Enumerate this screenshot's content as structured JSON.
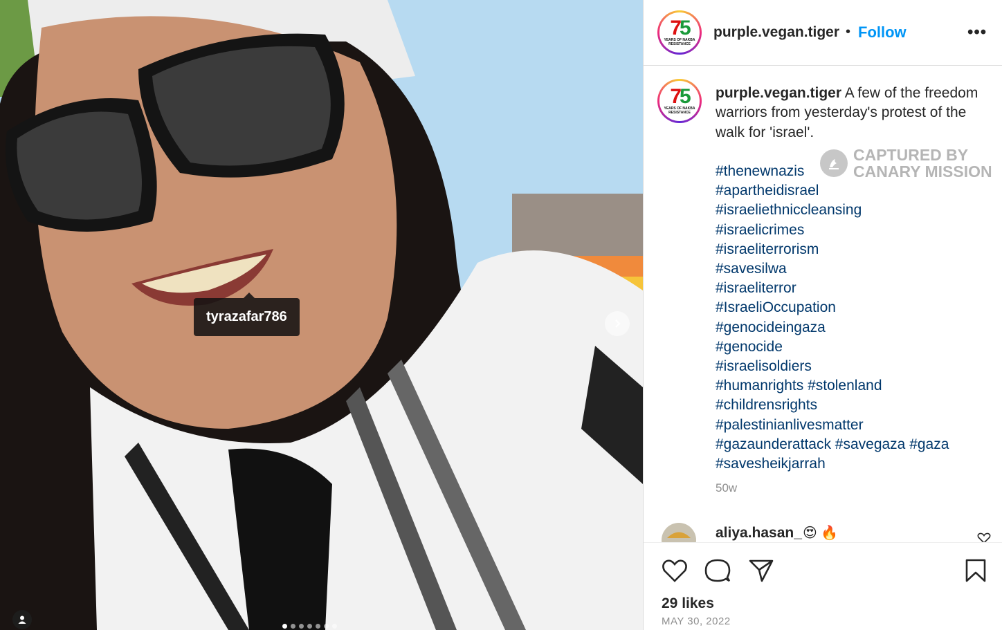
{
  "post": {
    "tagged_user": "tyrazafar786",
    "carousel": {
      "count": 7,
      "active_index": 0
    }
  },
  "header": {
    "username": "purple.vegan.tiger",
    "separator": "•",
    "follow_label": "Follow",
    "more_label": "•••"
  },
  "avatar_logo": {
    "digit_7": "7",
    "digit_5": "5",
    "line1": "YEARS OF NAKBA",
    "line2": "RESISTANCE"
  },
  "caption": {
    "username": "purple.vegan.tiger",
    "text": " A few of the freedom warriors from yesterday's protest of the walk for 'israel'.",
    "hashtag_lines": [
      "#thenewnazis",
      "#apartheidisrael",
      "#israeliethniccleansing",
      "#israelicrimes",
      "#israeliterrorism",
      "#savesilwa",
      "#israeliterror",
      "#IsraeliOccupation",
      "#genocideingaza",
      "#genocide",
      "#israelisoldiers",
      "#humanrights #stolenland",
      "#childrensrights",
      "#palestinianlivesmatter",
      "#gazaunderattack #savegaza #gaza",
      "#savesheikjarrah"
    ],
    "age": "50w"
  },
  "watermark": {
    "line1": "CAPTURED BY",
    "line2": "CANARY MISSION"
  },
  "comment": {
    "username": "aliya.hasan_",
    "emoji": "😍 🔥"
  },
  "footer": {
    "likes": "29 likes",
    "date": "MAY 30, 2022"
  },
  "colors": {
    "link": "#00376b",
    "follow": "#0095f6",
    "muted": "#8e8e8e"
  }
}
